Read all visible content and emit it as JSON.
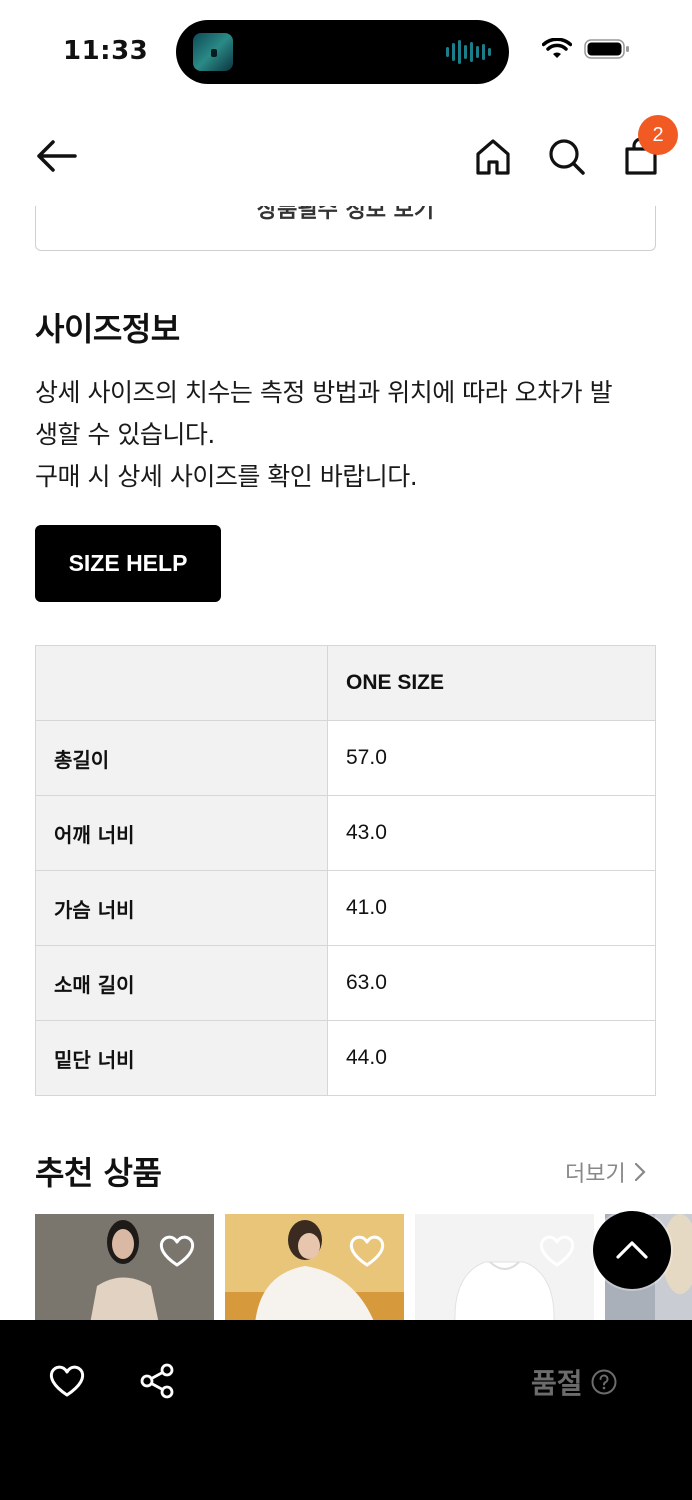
{
  "status_bar": {
    "time": "11:33"
  },
  "nav": {
    "cart_count": "2"
  },
  "previous_section": {
    "label": "상품필수 정보 보기"
  },
  "size_info": {
    "title": "사이즈정보",
    "description_lines": [
      "상세 사이즈의 치수는 측정 방법과 위치에 따라 오차가 발",
      "생할 수 있습니다.",
      "구매 시 상세 사이즈를 확인 바랍니다."
    ],
    "size_help_label": "SIZE HELP",
    "table": {
      "header": [
        "",
        "ONE SIZE"
      ],
      "rows": [
        {
          "label": "총길이",
          "value": "57.0"
        },
        {
          "label": "어깨 너비",
          "value": "43.0"
        },
        {
          "label": "가슴 너비",
          "value": "41.0"
        },
        {
          "label": "소매 길이",
          "value": "63.0"
        },
        {
          "label": "밑단 너비",
          "value": "44.0"
        }
      ]
    }
  },
  "recommended": {
    "title": "추천 상품",
    "more_label": "더보기"
  },
  "bottom_bar": {
    "soldout_label": "품절"
  },
  "colors": {
    "badge": "#f15a22",
    "button": "#000000",
    "table_header": "#f2f2f2"
  }
}
